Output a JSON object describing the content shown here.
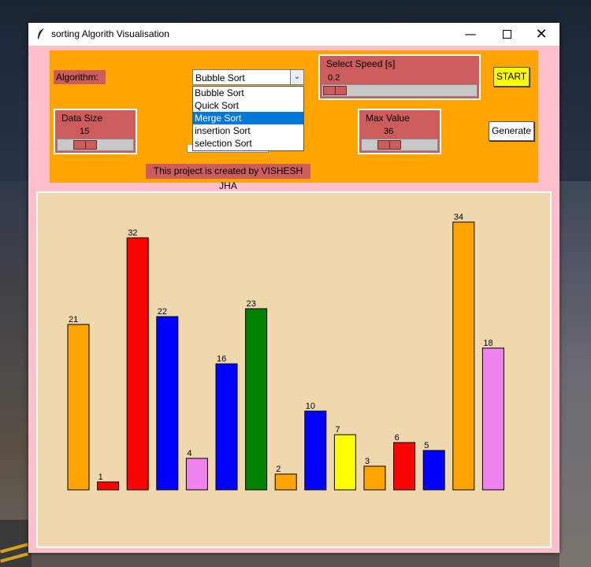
{
  "window": {
    "title": "sorting Algorith Visualisation"
  },
  "controls": {
    "algorithm_label": "Algorithm:",
    "algorithm_selected": "Bubble Sort",
    "algorithm_options": [
      "Bubble Sort",
      "Quick Sort",
      "Merge Sort",
      "insertion Sort",
      "selection Sort"
    ],
    "algorithm_highlighted": "Merge Sort",
    "speed": {
      "label": "Select Speed [s]",
      "value": "0.2"
    },
    "data_size": {
      "label": "Data Size",
      "value": "15"
    },
    "max_value": {
      "label": "Max Value",
      "value": "36"
    },
    "start_button": "START",
    "generate_button": "Generate",
    "credit": "This project is created by VISHESH JHA"
  },
  "colors": {
    "panel": "#ffa500",
    "label_bg": "#cd5c5c",
    "window_bg": "#ffc0cb",
    "canvas_bg": "#efd8ae"
  },
  "chart_data": {
    "type": "bar",
    "values": [
      21,
      1,
      32,
      22,
      4,
      16,
      23,
      2,
      10,
      7,
      3,
      6,
      5,
      34,
      18
    ],
    "colors": [
      "#ffa500",
      "#ff0000",
      "#ff0000",
      "#0000ff",
      "#ee82ee",
      "#0000ff",
      "#008000",
      "#ffa500",
      "#0000ff",
      "#ffff00",
      "#ffa500",
      "#ff0000",
      "#0000ff",
      "#ffa500",
      "#ee82ee"
    ],
    "ylim": [
      0,
      34
    ]
  }
}
